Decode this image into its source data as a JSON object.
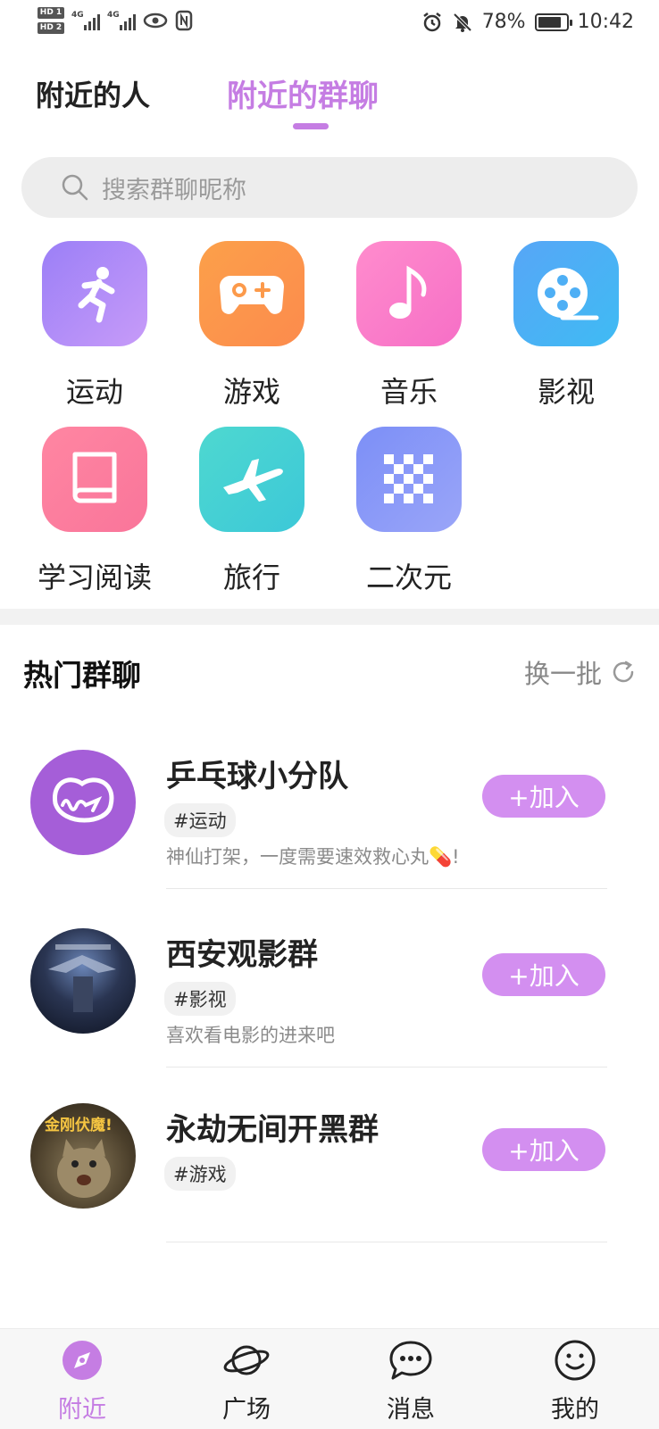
{
  "status_bar": {
    "hd_badges": [
      "HD 1",
      "HD 2"
    ],
    "network": [
      "4G",
      "4G"
    ],
    "battery": "78%",
    "time": "10:42"
  },
  "tabs": [
    {
      "label": "附近的人",
      "active": false
    },
    {
      "label": "附近的群聊",
      "active": true
    }
  ],
  "search": {
    "placeholder": "搜索群聊昵称"
  },
  "categories": [
    {
      "label": "运动",
      "icon": "running-icon"
    },
    {
      "label": "游戏",
      "icon": "gamepad-icon"
    },
    {
      "label": "音乐",
      "icon": "music-note-icon"
    },
    {
      "label": "影视",
      "icon": "film-reel-icon"
    },
    {
      "label": "学习阅读",
      "icon": "book-icon"
    },
    {
      "label": "旅行",
      "icon": "airplane-icon"
    },
    {
      "label": "二次元",
      "icon": "checkerboard-icon"
    }
  ],
  "hot": {
    "title": "热门群聊",
    "refresh_label": "换一批",
    "groups": [
      {
        "name": "乒乓球小分队",
        "tag": "#运动",
        "desc": "神仙打架，一度需要速效救心丸💊!",
        "join_label": "+加入"
      },
      {
        "name": "西安观影群",
        "tag": "#影视",
        "desc": "喜欢看电影的进来吧",
        "join_label": "+加入"
      },
      {
        "name": "永劫无间开黑群",
        "tag": "#游戏",
        "desc": "",
        "join_label": "+加入",
        "avatar_text": "金刚伏魔!"
      }
    ]
  },
  "bottom_nav": [
    {
      "label": "附近",
      "icon": "compass-icon",
      "active": true
    },
    {
      "label": "广场",
      "icon": "planet-icon",
      "active": false
    },
    {
      "label": "消息",
      "icon": "chat-bubble-icon",
      "active": false
    },
    {
      "label": "我的",
      "icon": "smiley-icon",
      "active": false
    }
  ],
  "colors": {
    "accent": "#c57de3",
    "join_button": "#d38ff0"
  }
}
